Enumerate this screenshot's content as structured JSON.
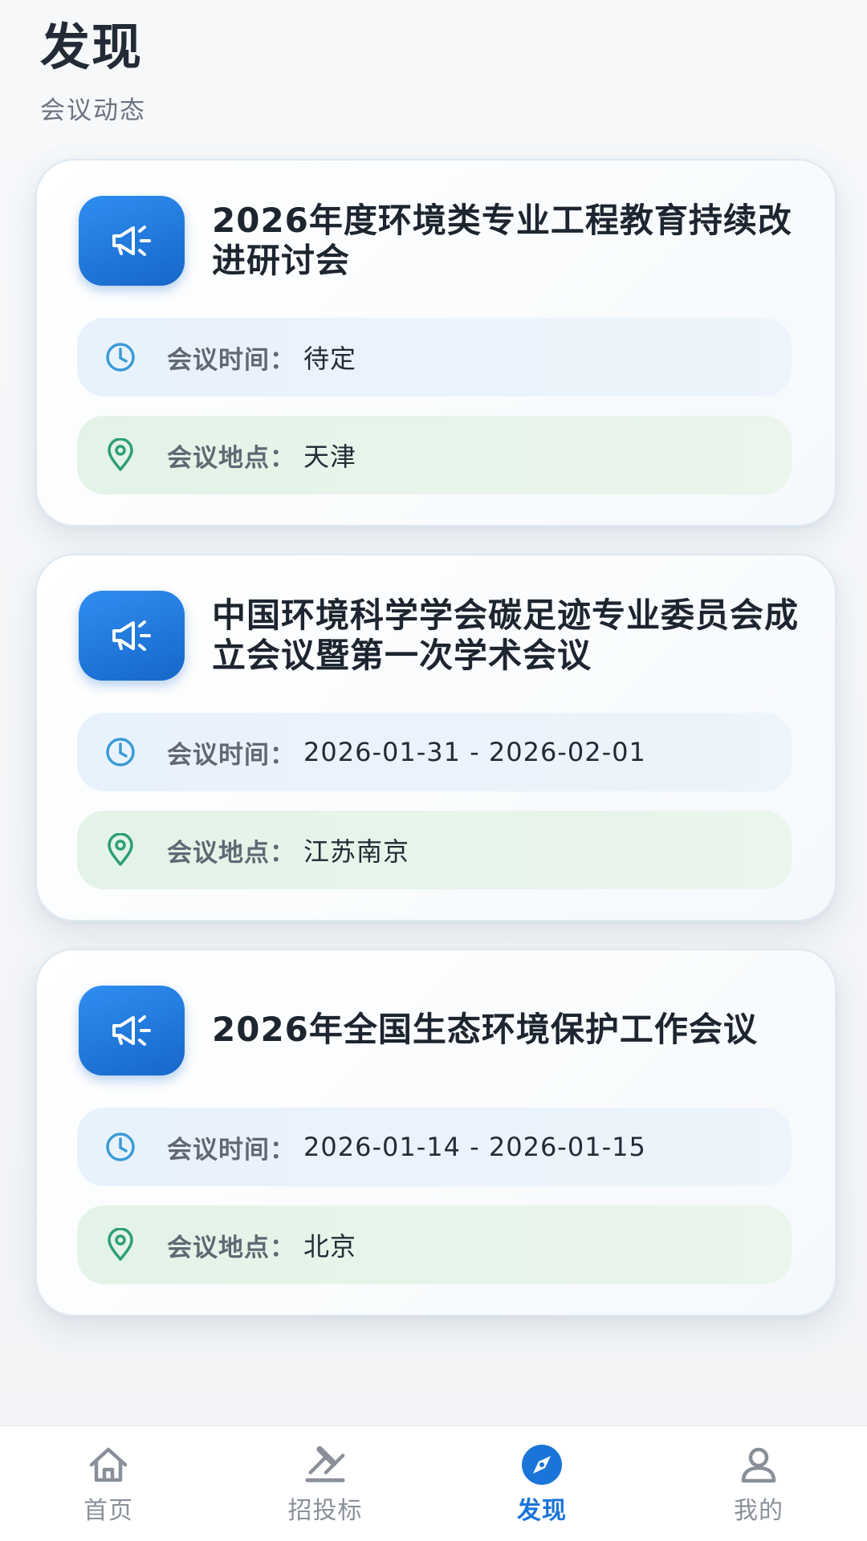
{
  "header": {
    "title": "发现",
    "subtitle": "会议动态"
  },
  "colors": {
    "accent": "#1b74d8",
    "time_row_bg": "#e8f2fc",
    "location_row_bg": "#e3f3e7",
    "time_icon": "#3a9bd6",
    "location_icon": "#2e9e7a"
  },
  "meetings": [
    {
      "title": "2026年度环境类专业工程教育持续改进研讨会",
      "icon": "megaphone-icon",
      "time_label": "会议时间：",
      "time_value": "待定",
      "location_label": "会议地点：",
      "location_value": "天津"
    },
    {
      "title": "中国环境科学学会碳足迹专业委员会成立会议暨第一次学术会议",
      "icon": "megaphone-icon",
      "time_label": "会议时间：",
      "time_value": "2026-01-31 - 2026-02-01",
      "location_label": "会议地点：",
      "location_value": "江苏南京"
    },
    {
      "title": "2026年全国生态环境保护工作会议",
      "icon": "megaphone-icon",
      "time_label": "会议时间：",
      "time_value": "2026-01-14 - 2026-01-15",
      "location_label": "会议地点：",
      "location_value": "北京"
    }
  ],
  "tabbar": {
    "items": [
      {
        "label": "首页",
        "icon": "home-icon",
        "active": false
      },
      {
        "label": "招投标",
        "icon": "gavel-icon",
        "active": false
      },
      {
        "label": "发现",
        "icon": "compass-icon",
        "active": true
      },
      {
        "label": "我的",
        "icon": "user-icon",
        "active": false
      }
    ]
  }
}
